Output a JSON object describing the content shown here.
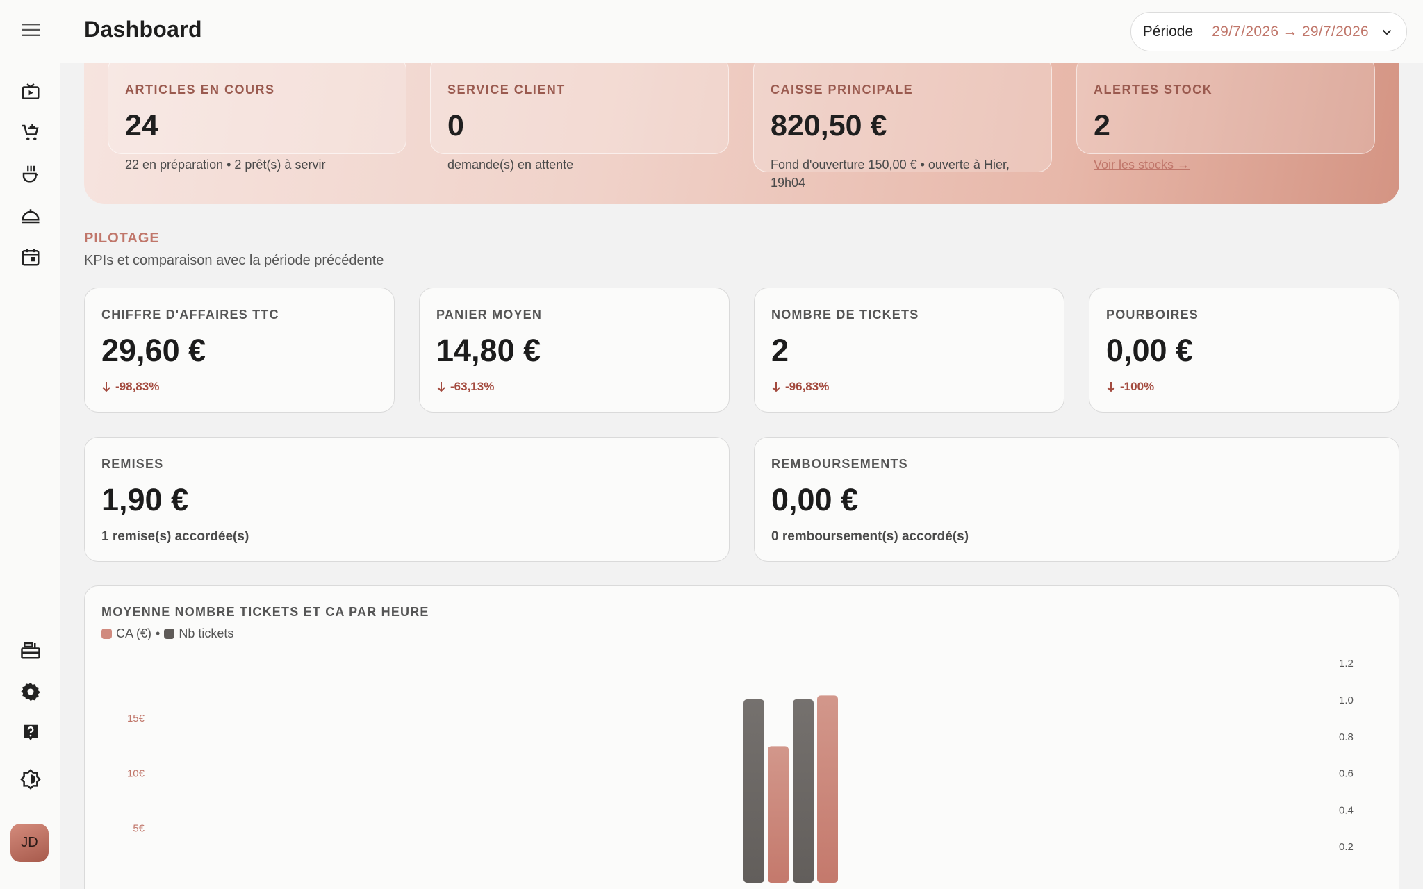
{
  "app": {
    "title": "Dashboard"
  },
  "period": {
    "label": "Période",
    "range": "29/7/2026 → 29/7/2026"
  },
  "sidebar": {
    "items": [
      "tv-play-icon",
      "cart-add-icon",
      "chef-icon",
      "room-service-icon",
      "calendar-icon",
      "cash-register-icon",
      "settings-icon",
      "help-icon",
      "theme-contrast-icon"
    ],
    "user_initials": "JD"
  },
  "live": [
    {
      "label": "ARTICLES EN COURS",
      "value": "24",
      "sub": "22 en préparation • 2 prêt(s) à servir"
    },
    {
      "label": "SERVICE CLIENT",
      "value": "0",
      "sub": "demande(s) en attente"
    },
    {
      "label": "CAISSE PRINCIPALE",
      "value": "820,50 €",
      "sub": "Fond d'ouverture 150,00 € • ouverte à Hier, 19h04"
    },
    {
      "label": "ALERTES STOCK",
      "value": "2",
      "sub": "Voir les stocks →"
    }
  ],
  "pilotage": {
    "title": "PILOTAGE",
    "subtitle": "KPIs et comparaison avec la période précédente"
  },
  "kpis": [
    {
      "label": "CHIFFRE D'AFFAIRES TTC",
      "value": "29,60 €",
      "delta": "-98,83%"
    },
    {
      "label": "PANIER MOYEN",
      "value": "14,80 €",
      "delta": "-63,13%"
    },
    {
      "label": "NOMBRE DE TICKETS",
      "value": "2",
      "delta": "-96,83%"
    },
    {
      "label": "POURBOIRES",
      "value": "0,00 €",
      "delta": "-100%"
    }
  ],
  "kpis2": [
    {
      "label": "REMISES",
      "value": "1,90 €",
      "sub": "1 remise(s) accordée(s)"
    },
    {
      "label": "REMBOURSEMENTS",
      "value": "0,00 €",
      "sub": "0 remboursement(s) accordé(s)"
    }
  ],
  "chart": {
    "title": "MOYENNE NOMBRE TICKETS ET CA PAR HEURE",
    "legend_ca": "CA (€)",
    "legend_sep": "•",
    "legend_tickets": "Nb tickets"
  },
  "colors": {
    "accent": "#c0766a",
    "ca": "#d08a7e",
    "tickets": "#6e6a67"
  },
  "chart_data": {
    "type": "bar",
    "title": "MOYENNE NOMBRE TICKETS ET CA PAR HEURE",
    "categories": [
      "",
      ""
    ],
    "series": [
      {
        "name": "Nb tickets",
        "axis": "right",
        "values": [
          1,
          1
        ]
      },
      {
        "name": "CA (€)",
        "axis": "left",
        "values": [
          12.4,
          17.0
        ]
      }
    ],
    "y_left": {
      "ticks": [
        "5€",
        "10€",
        "15€"
      ],
      "tick_values": [
        5,
        10,
        15
      ]
    },
    "y_right": {
      "ticks": [
        "0.2",
        "0.4",
        "0.6",
        "0.8",
        "1.0",
        "1.2"
      ],
      "tick_values": [
        0.2,
        0.4,
        0.6,
        0.8,
        1.0,
        1.2
      ]
    },
    "grid": false,
    "legend": "top-left"
  }
}
